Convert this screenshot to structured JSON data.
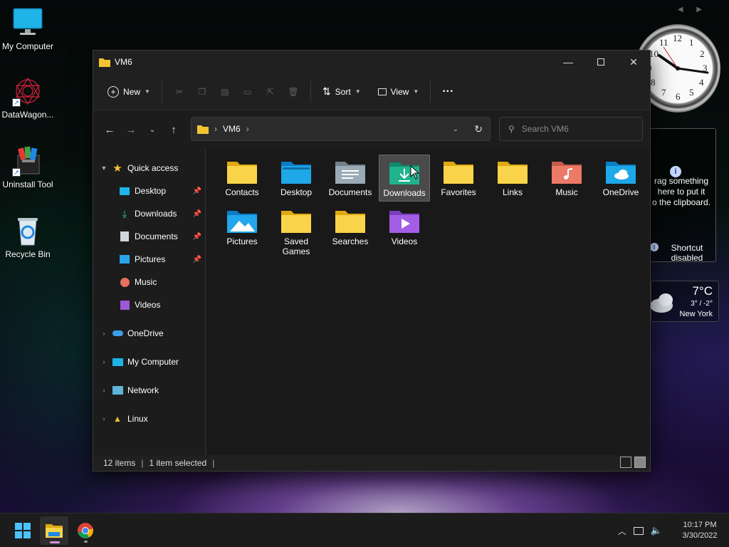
{
  "desktop": {
    "icons": [
      {
        "label": "My Computer"
      },
      {
        "label": "DataWagon..."
      },
      {
        "label": "Uninstall Tool"
      },
      {
        "label": "Recycle Bin"
      }
    ],
    "gadget_arrows": "◀ ▶",
    "clock": {
      "numbers": [
        "12",
        "1",
        "2",
        "3",
        "4",
        "5",
        "6",
        "7",
        "8",
        "9",
        "10",
        "11"
      ]
    },
    "clipboard_gadget": {
      "line1": "rag something",
      "line2": "here to put it",
      "line3": "o the clipboard.",
      "shortcut": "Shortcut",
      "shortcut2": "disabled"
    },
    "weather": {
      "temp": "7°C",
      "range": "3° / -2°",
      "city": "New York"
    }
  },
  "window": {
    "title": "VM6",
    "toolbar": {
      "new_label": "New",
      "sort_label": "Sort",
      "view_label": "View",
      "more_label": "···"
    },
    "address": {
      "path": "VM6"
    },
    "search": {
      "placeholder": "Search VM6"
    },
    "nav": {
      "quick_access": "Quick access",
      "quick_items": [
        {
          "label": "Desktop",
          "pinned": true
        },
        {
          "label": "Downloads",
          "pinned": true
        },
        {
          "label": "Documents",
          "pinned": true
        },
        {
          "label": "Pictures",
          "pinned": true
        },
        {
          "label": "Music",
          "pinned": false
        },
        {
          "label": "Videos",
          "pinned": false
        }
      ],
      "roots": [
        "OneDrive",
        "My Computer",
        "Network",
        "Linux"
      ]
    },
    "items": [
      {
        "name": "Contacts",
        "kind": "folder"
      },
      {
        "name": "Desktop",
        "kind": "desktop"
      },
      {
        "name": "Documents",
        "kind": "documents"
      },
      {
        "name": "Downloads",
        "kind": "downloads",
        "selected": true
      },
      {
        "name": "Favorites",
        "kind": "folder"
      },
      {
        "name": "Links",
        "kind": "folder"
      },
      {
        "name": "Music",
        "kind": "music"
      },
      {
        "name": "OneDrive",
        "kind": "onedrive"
      },
      {
        "name": "Pictures",
        "kind": "pictures"
      },
      {
        "name": "Saved Games",
        "kind": "folder"
      },
      {
        "name": "Searches",
        "kind": "folder"
      },
      {
        "name": "Videos",
        "kind": "videos"
      }
    ],
    "status": {
      "count": "12 items",
      "selected": "1 item selected"
    }
  },
  "taskbar": {
    "time": "10:17 PM",
    "date": "3/30/2022"
  },
  "colors": {
    "accent": "#60cdff",
    "folder": "#f4c430",
    "selection": "#4a4a4a"
  }
}
